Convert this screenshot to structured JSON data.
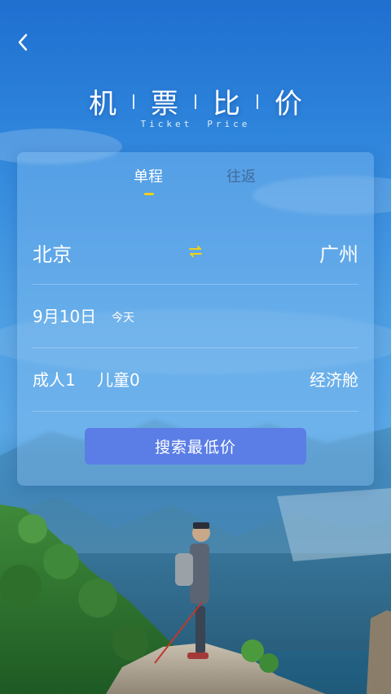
{
  "header": {
    "title_chars": [
      "机",
      "票",
      "比",
      "价"
    ],
    "subtitle_words": [
      "Ticket",
      "Price"
    ]
  },
  "tabs": {
    "oneway": "单程",
    "roundtrip": "往返"
  },
  "route": {
    "from": "北京",
    "to": "广州"
  },
  "date": {
    "main": "9月10日",
    "sub": "今天"
  },
  "passengers": {
    "adult": "成人1",
    "child": "儿童0",
    "cabin": "经济舱"
  },
  "search": {
    "label": "搜索最低价"
  },
  "icons": {
    "back": "back-icon",
    "swap": "swap-icon"
  },
  "colors": {
    "accent": "#f2d11a",
    "button": "#5b7ee6",
    "sky": "#2f86dc"
  }
}
